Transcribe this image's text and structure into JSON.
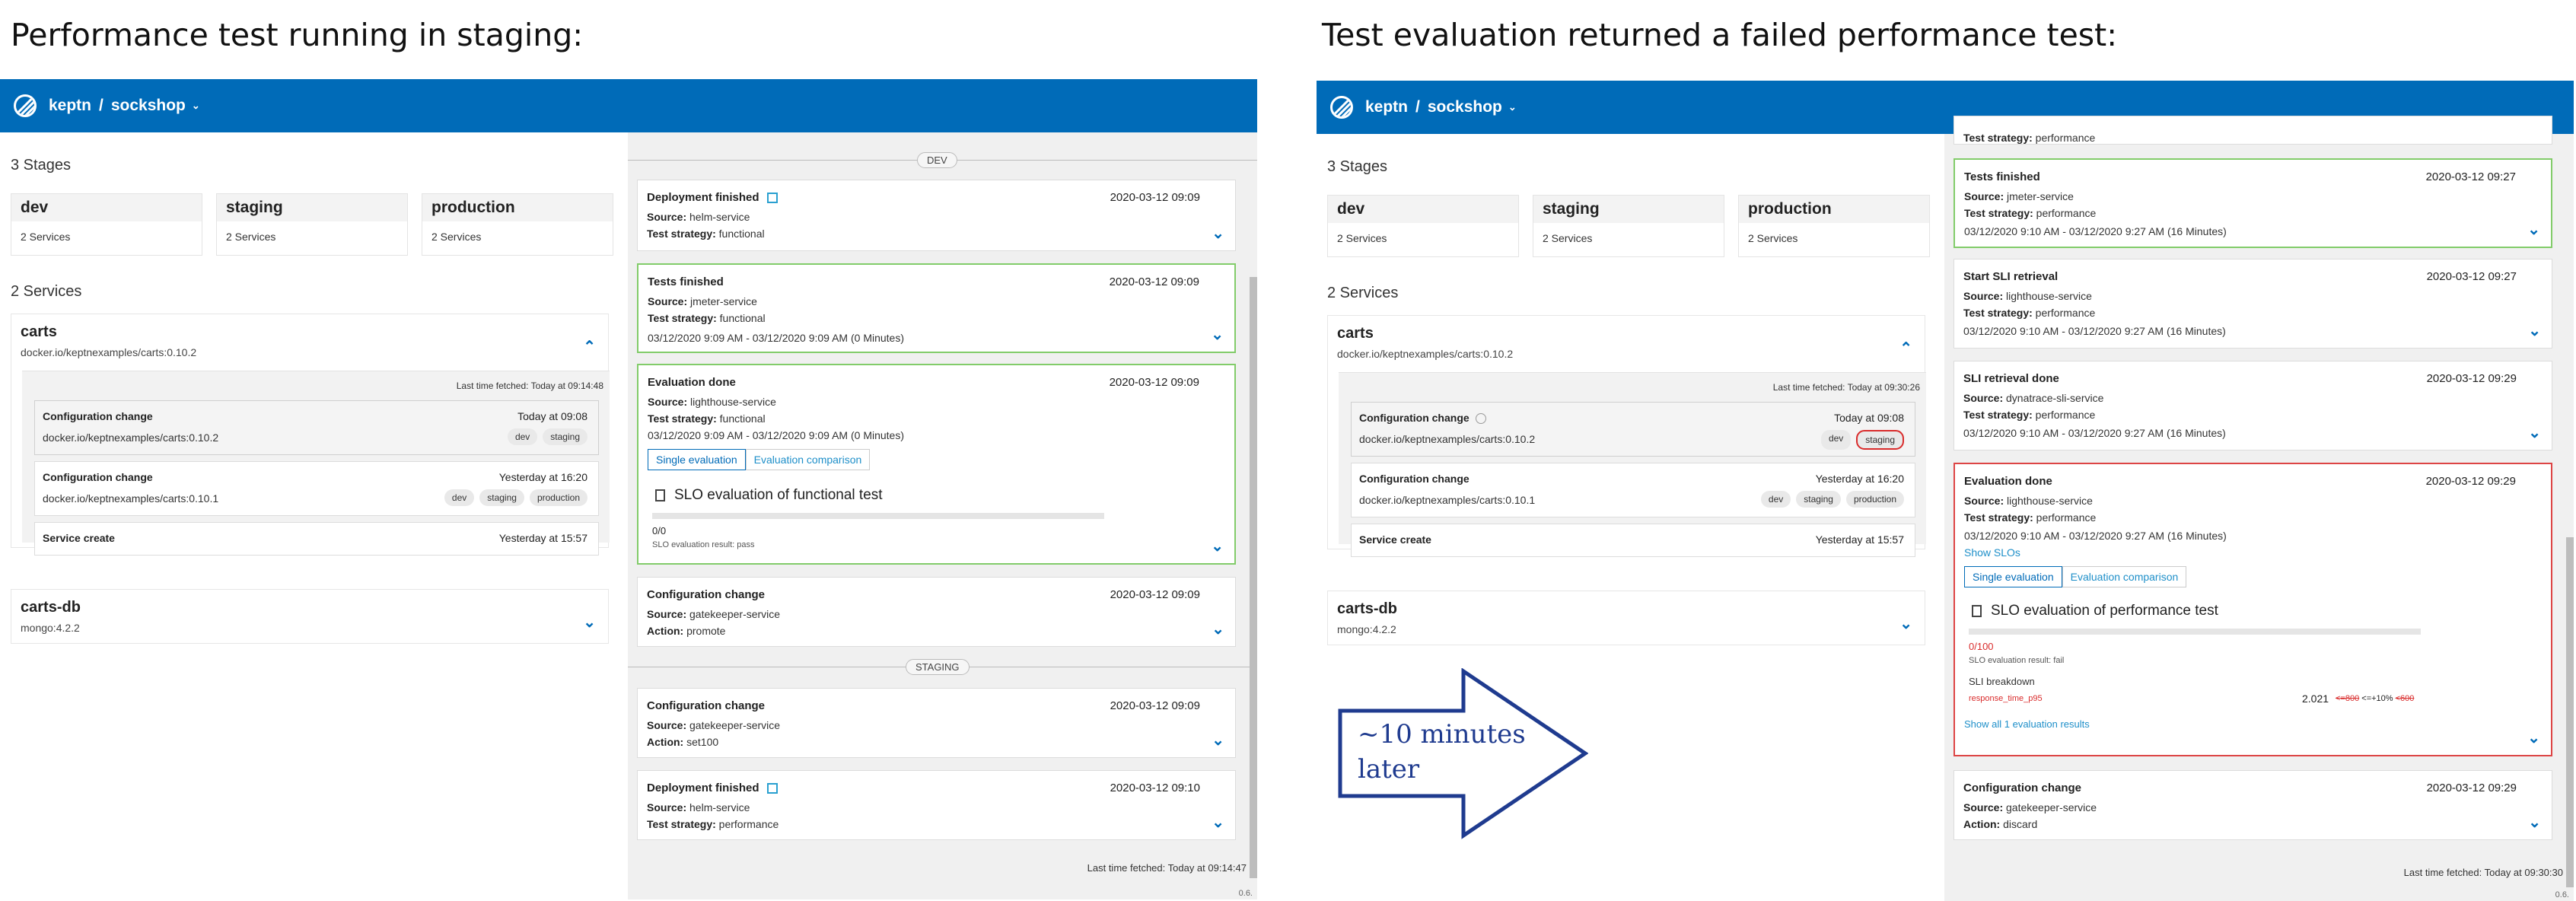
{
  "titles": {
    "left": "Performance test running in staging:",
    "right": "Test evaluation returned a failed performance test:"
  },
  "header": {
    "brand": "keptn",
    "separator": "/",
    "project": "sockshop",
    "dropdown_glyph": "⌄"
  },
  "colors": {
    "header": "#006bb8",
    "pass_border": "#82cc6a",
    "fail_border": "#dd4444",
    "fail_text": "#d92c2c"
  },
  "stages_heading": "3 Stages",
  "stages": [
    {
      "name": "dev",
      "services": "2 Services"
    },
    {
      "name": "staging",
      "services": "2 Services"
    },
    {
      "name": "production",
      "services": "2 Services"
    }
  ],
  "services_heading": "2 Services",
  "expand_glyph": "⌃",
  "collapse_glyph": "⌄",
  "left": {
    "carts": {
      "name": "carts",
      "image": "docker.io/keptnexamples/carts:0.10.2"
    },
    "last_fetched": "Last time fetched: Today at 09:14:48",
    "events": [
      {
        "title": "Configuration change",
        "when": "Today at 09:08",
        "image": "docker.io/keptnexamples/carts:0.10.2",
        "tags": [
          "dev",
          "staging"
        ]
      },
      {
        "title": "Configuration change",
        "when": "Yesterday at 16:20",
        "image": "docker.io/keptnexamples/carts:0.10.1",
        "tags": [
          "dev",
          "staging",
          "production"
        ]
      },
      {
        "title": "Service create",
        "when": "Yesterday at 15:57"
      }
    ],
    "cartsdb": {
      "name": "carts-db",
      "image": "mongo:4.2.2"
    },
    "feed": {
      "dev_label": "DEV",
      "staging_label": "STAGING",
      "cards": [
        {
          "title": "Deployment finished",
          "date": "2020-03-12 09:09",
          "l1k": "Source:",
          "l1v": " helm-service",
          "l2k": "Test strategy:",
          "l2v": " functional"
        },
        {
          "title": "Tests finished",
          "date": "2020-03-12 09:09",
          "l1k": "Source:",
          "l1v": " jmeter-service",
          "l2k": "Test strategy:",
          "l2v": " functional",
          "l3": "03/12/2020 9:09 AM - 03/12/2020 9:09 AM (0 Minutes)"
        },
        {
          "title": "Evaluation done",
          "date": "2020-03-12 09:09",
          "l1k": "Source:",
          "l1v": " lighthouse-service",
          "l2k": "Test strategy:",
          "l2v": " functional",
          "l3": "03/12/2020 9:09 AM - 03/12/2020 9:09 AM (0 Minutes)",
          "btn1": "Single evaluation",
          "btn2": "Evaluation comparison",
          "slo": "SLO evaluation of functional test",
          "score": "0/0",
          "result": "SLO evaluation result: pass"
        },
        {
          "title": "Configuration change",
          "date": "2020-03-12 09:09",
          "l1k": "Source:",
          "l1v": " gatekeeper-service",
          "l2k": "Action:",
          "l2v": " promote"
        },
        {
          "title": "Configuration change",
          "date": "2020-03-12 09:09",
          "l1k": "Source:",
          "l1v": " gatekeeper-service",
          "l2k": "Action:",
          "l2v": " set100"
        },
        {
          "title": "Deployment finished",
          "date": "2020-03-12 09:10",
          "l1k": "Source:",
          "l1v": " helm-service",
          "l2k": "Test strategy:",
          "l2v": " performance"
        }
      ],
      "last_fetched": "Last time fetched: Today at 09:14:47",
      "version": "0.6."
    }
  },
  "right": {
    "carts": {
      "name": "carts",
      "image": "docker.io/keptnexamples/carts:0.10.2"
    },
    "last_fetched": "Last time fetched: Today at 09:30:26",
    "events": [
      {
        "title": "Configuration change",
        "when": "Today at 09:08",
        "image": "docker.io/keptnexamples/carts:0.10.2",
        "tags": [
          "dev",
          "staging"
        ]
      },
      {
        "title": "Configuration change",
        "when": "Yesterday at 16:20",
        "image": "docker.io/keptnexamples/carts:0.10.1",
        "tags": [
          "dev",
          "staging",
          "production"
        ]
      },
      {
        "title": "Service create",
        "when": "Yesterday at 15:57"
      }
    ],
    "cartsdb": {
      "name": "carts-db",
      "image": "mongo:4.2.2"
    },
    "feed": {
      "top_k": "Test strategy:",
      "top_v": " performance",
      "cards": [
        {
          "title": "Tests finished",
          "date": "2020-03-12 09:27",
          "l1k": "Source:",
          "l1v": " jmeter-service",
          "l2k": "Test strategy:",
          "l2v": " performance",
          "l3": "03/12/2020 9:10 AM - 03/12/2020 9:27 AM (16 Minutes)"
        },
        {
          "title": "Start SLI retrieval",
          "date": "2020-03-12 09:27",
          "l1k": "Source:",
          "l1v": " lighthouse-service",
          "l2k": "Test strategy:",
          "l2v": " performance",
          "l3": "03/12/2020 9:10 AM - 03/12/2020 9:27 AM (16 Minutes)"
        },
        {
          "title": "SLI retrieval done",
          "date": "2020-03-12 09:29",
          "l1k": "Source:",
          "l1v": " dynatrace-sli-service",
          "l2k": "Test strategy:",
          "l2v": " performance",
          "l3": "03/12/2020 9:10 AM - 03/12/2020 9:27 AM (16 Minutes)"
        },
        {
          "title": "Evaluation done",
          "date": "2020-03-12 09:29",
          "l1k": "Source:",
          "l1v": " lighthouse-service",
          "l2k": "Test strategy:",
          "l2v": " performance",
          "l3": "03/12/2020 9:10 AM - 03/12/2020 9:27 AM (16 Minutes)",
          "show_slos": "Show SLOs",
          "btn1": "Single evaluation",
          "btn2": "Evaluation comparison",
          "slo": "SLO evaluation of performance test",
          "score": "0/100",
          "result": "SLO evaluation result: fail",
          "breakdown": "SLI breakdown",
          "sli_name": "response_time_p95",
          "sli_value": "2.021",
          "sli_c1": "<=800",
          "sli_c2": "<=+10%",
          "sli_c3": "<600",
          "show_all": "Show all 1 evaluation results"
        },
        {
          "title": "Configuration change",
          "date": "2020-03-12 09:29",
          "l1k": "Source:",
          "l1v": " gatekeeper-service",
          "l2k": "Action:",
          "l2v": " discard"
        }
      ],
      "last_fetched": "Last time fetched: Today at 09:30:30",
      "version": "0.6."
    }
  },
  "annotation": {
    "line1": "~10 minutes",
    "line2": "later"
  }
}
